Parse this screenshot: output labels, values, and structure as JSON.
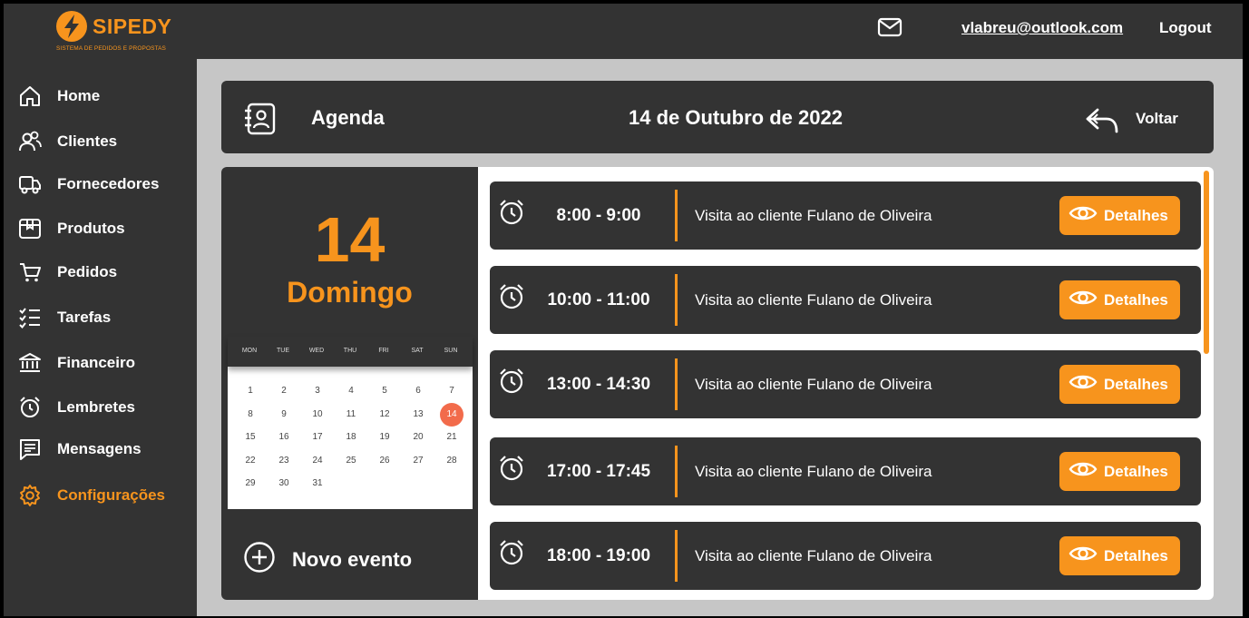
{
  "brand": {
    "name": "SIPEDY",
    "tagline": "SISTEMA DE PEDIDOS E PROPOSTAS",
    "accent": "#f7941d"
  },
  "topbar": {
    "user_email": "vlabreu@outlook.com",
    "logout_label": "Logout",
    "mail_icon": "mail-icon"
  },
  "sidebar": {
    "items": [
      {
        "label": "Home",
        "icon": "home-icon"
      },
      {
        "label": "Clientes",
        "icon": "users-icon"
      },
      {
        "label": "Fornecedores",
        "icon": "truck-icon"
      },
      {
        "label": "Produtos",
        "icon": "box-icon"
      },
      {
        "label": "Pedidos",
        "icon": "cart-icon"
      },
      {
        "label": "Tarefas",
        "icon": "checklist-icon"
      },
      {
        "label": "Financeiro",
        "icon": "bank-icon"
      },
      {
        "label": "Lembretes",
        "icon": "alarm-icon"
      },
      {
        "label": "Mensagens",
        "icon": "message-icon"
      },
      {
        "label": "Configurações",
        "icon": "gear-icon",
        "active": true
      }
    ]
  },
  "header": {
    "title": "Agenda",
    "date": "14 de Outubro de 2022",
    "back_label": "Voltar"
  },
  "day_panel": {
    "day_number": "14",
    "weekday": "Domingo",
    "new_event_label": "Novo evento"
  },
  "calendar": {
    "weekdays": [
      "MON",
      "TUE",
      "WED",
      "THU",
      "FRI",
      "SAT",
      "SUN"
    ],
    "weeks": [
      [
        "1",
        "2",
        "3",
        "4",
        "5",
        "6",
        "7"
      ],
      [
        "8",
        "9",
        "10",
        "11",
        "12",
        "13",
        "14"
      ],
      [
        "15",
        "16",
        "17",
        "18",
        "19",
        "20",
        "21"
      ],
      [
        "22",
        "23",
        "24",
        "25",
        "26",
        "27",
        "28"
      ],
      [
        "29",
        "30",
        "31"
      ]
    ],
    "selected": "14",
    "selected_color": "#f26b4b"
  },
  "events": [
    {
      "time": "8:00 - 9:00",
      "description": "Visita ao cliente Fulano de Oliveira",
      "button_label": "Detalhes"
    },
    {
      "time": "10:00 - 11:00",
      "description": "Visita ao cliente Fulano de Oliveira",
      "button_label": "Detalhes"
    },
    {
      "time": "13:00 - 14:30",
      "description": "Visita ao cliente Fulano de Oliveira",
      "button_label": "Detalhes"
    },
    {
      "time": "17:00 - 17:45",
      "description": "Visita ao cliente Fulano de Oliveira",
      "button_label": "Detalhes"
    },
    {
      "time": "18:00 - 19:00",
      "description": "Visita ao cliente Fulano de Oliveira",
      "button_label": "Detalhes"
    }
  ]
}
